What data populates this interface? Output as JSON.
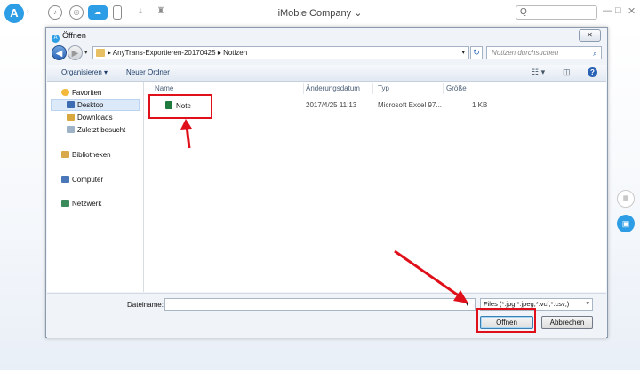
{
  "app": {
    "title": "iMobie Company",
    "title_caret": "⌄",
    "logo_letter": "A",
    "search_glyph": "Q",
    "window_controls": [
      "—",
      "□",
      "✕"
    ]
  },
  "dialog": {
    "title": "Öffnen",
    "close_glyph": "✕",
    "breadcrumb": [
      "AnyTrans-Exportieren-20170425",
      "Notizen"
    ],
    "breadcrumb_sep": "▸",
    "search_placeholder": "Notizen durchsuchen",
    "toolbar": {
      "organize": "Organisieren ▾",
      "new_folder": "Neuer Ordner",
      "help": "?"
    },
    "nav": {
      "favorites": "Favoriten",
      "desktop": "Desktop",
      "downloads": "Downloads",
      "recent": "Zuletzt besucht",
      "libraries": "Bibliotheken",
      "computer": "Computer",
      "network": "Netzwerk"
    },
    "columns": {
      "name": "Name",
      "modified": "Änderungsdatum",
      "type": "Typ",
      "size": "Größe"
    },
    "file": {
      "name": "Note",
      "modified": "2017/4/25 11:13",
      "type": "Microsoft Excel 97...",
      "size": "1 KB"
    },
    "filename_label": "Dateiname:",
    "filename_value": "",
    "filter": "Files (*.jpg;*.jpeg;*.vcf;*.csv;)",
    "open_button": "Öffnen",
    "cancel_button": "Abbrechen"
  },
  "colors": {
    "accent": "#2d9de6",
    "highlight": "#e0101a"
  }
}
